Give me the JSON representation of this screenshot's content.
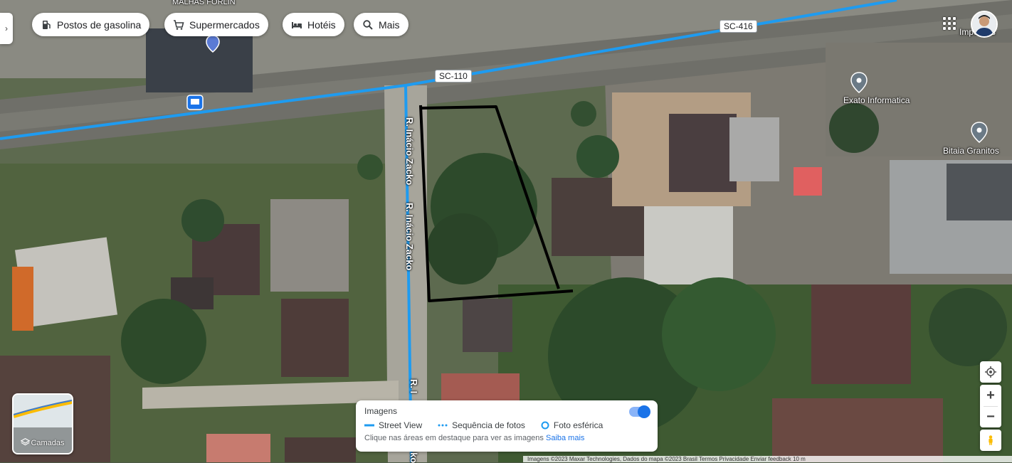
{
  "filter_chips": [
    {
      "label": "Postos de gasolina",
      "icon": "gas-station-icon"
    },
    {
      "label": "Supermercados",
      "icon": "cart-icon"
    },
    {
      "label": "Hotéis",
      "icon": "bed-icon"
    },
    {
      "label": "Mais",
      "icon": "search-icon"
    }
  ],
  "roads": {
    "sc416": "SC-416",
    "sc110": "SC-110",
    "street_vertical_1": "R. Inácio Zacko",
    "street_vertical_2": "R. Inácio Zacko",
    "street_vertical_partial": "R. I",
    "street_bottom_partial": "ko"
  },
  "pois": {
    "exato": "Exato Informatica",
    "bitaia": "Bitaia Granitos",
    "top_left_partial": "MALHAS FORLIN",
    "top_right_partial": "Impo   Bas"
  },
  "layers_button": {
    "label": "Camadas"
  },
  "imagery_panel": {
    "title": "Imagens",
    "legend_street_view": "Street View",
    "legend_sequence": "Sequência de fotos",
    "legend_spherical": "Foto esférica",
    "hint": "Clique nas áreas em destaque para ver as imagens",
    "learn_more": "Saiba mais"
  },
  "footer": {
    "text": "Imagens ©2023 Maxar Technologies, Dados do mapa ©2023     Brasil     Termos     Privacidade     Enviar feedback     10 m"
  },
  "colors": {
    "street_view_line": "#1e9bf0",
    "accent": "#1a73e8"
  }
}
